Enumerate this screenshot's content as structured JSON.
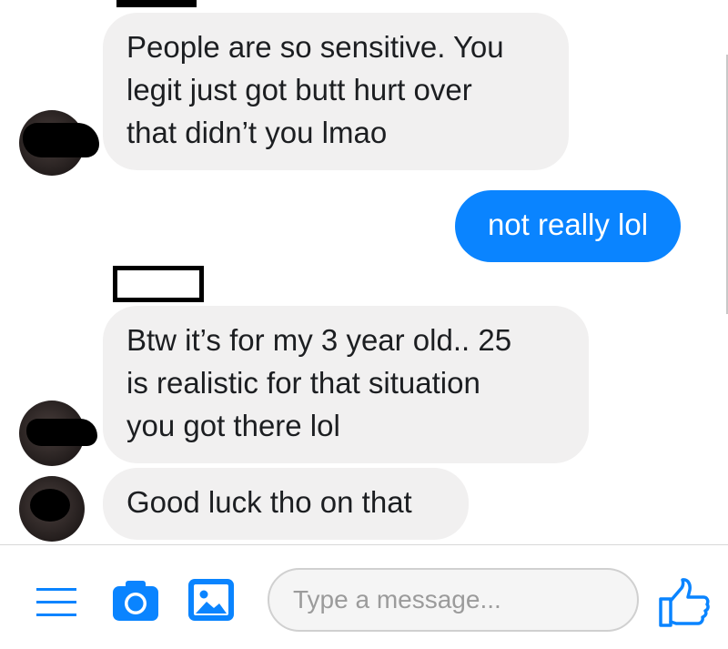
{
  "conversation": {
    "messages": [
      {
        "direction": "incoming",
        "text": "People are so sensitive. You\nlegit just got butt hurt over\nthat didn’t you lmao"
      },
      {
        "direction": "outgoing",
        "text": "not really lol"
      },
      {
        "direction": "incoming",
        "text": "Btw it’s for my 3 year old.. 25\nis realistic for that situation\nyou got there lol"
      },
      {
        "direction": "incoming",
        "text": "Good luck tho on that"
      }
    ]
  },
  "composer": {
    "placeholder": "Type a message...",
    "icons": [
      "menu-icon",
      "camera-icon",
      "gallery-icon",
      "like-icon"
    ]
  },
  "colors": {
    "accent": "#0a84ff",
    "incoming_bubble": "#f1f0f0",
    "outgoing_text": "#ffffff"
  }
}
